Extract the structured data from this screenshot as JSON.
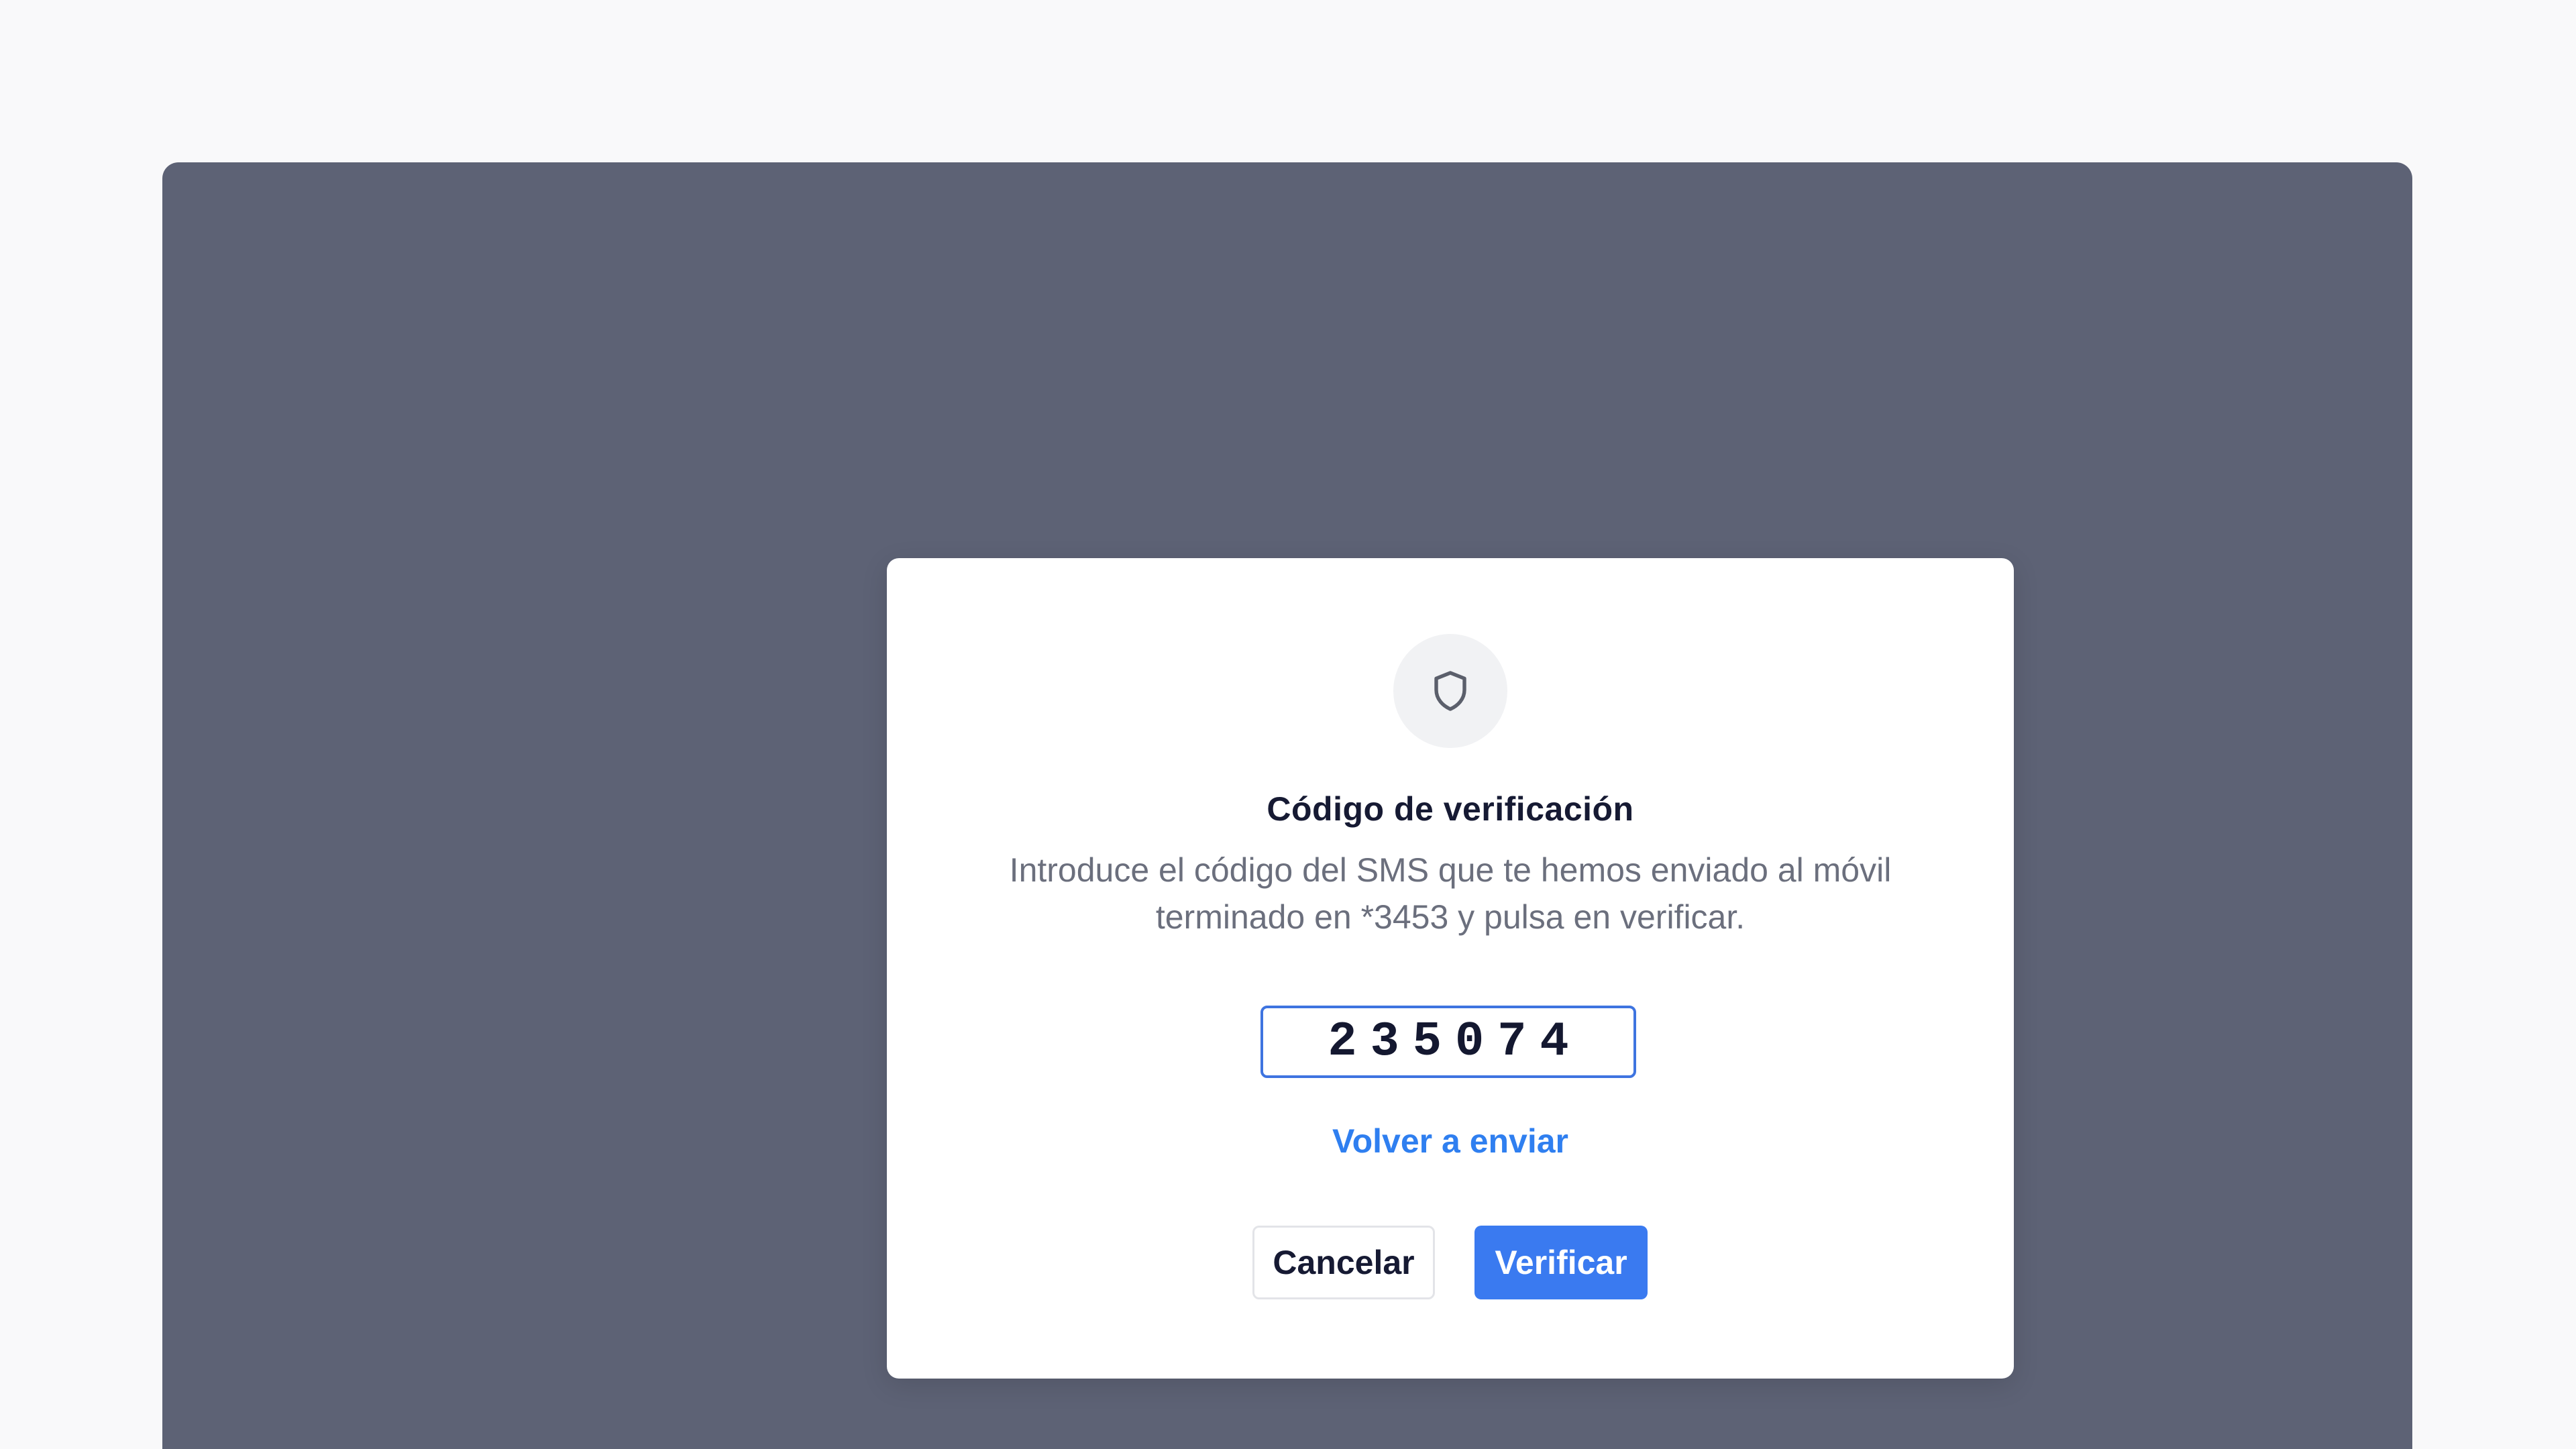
{
  "dialog": {
    "title": "Código de verificación",
    "description": "Introduce el código del SMS que te hemos enviado al móvil terminado en *3453 y pulsa en verificar.",
    "code_value": "235074",
    "resend_label": "Volver a enviar",
    "cancel_label": "Cancelar",
    "verify_label": "Verificar",
    "icon": "shield-icon"
  },
  "colors": {
    "page_background": "#f9f9fa",
    "overlay": "#5d6275",
    "accent": "#3a7af0",
    "title_text": "#161a33",
    "body_text": "#6b6f7d"
  }
}
